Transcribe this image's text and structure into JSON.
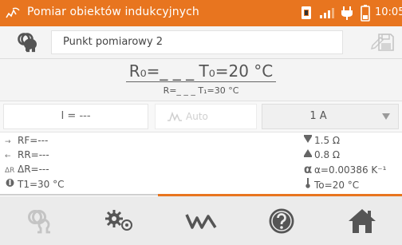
{
  "statusbar": {
    "title": "Pomiar obiektów indukcyjnych",
    "time": "10:05"
  },
  "point": {
    "name": "Punkt pomiarowy 2"
  },
  "result": {
    "r0_label": "R₀=",
    "r0_value": "_ _ _",
    "t0": "T₀=20 °C",
    "r_line": "R=_ _ _  T₁=30 °C"
  },
  "controls": {
    "current": "I = ---",
    "auto_label": "Auto",
    "range_value": "1 A"
  },
  "params": {
    "left": [
      {
        "prefix": "→",
        "text": "RF=---"
      },
      {
        "prefix": "←",
        "text": "RR=---"
      },
      {
        "prefix": "ΔR",
        "text": "ΔR=---"
      },
      {
        "prefix": "",
        "text": "T1=30 °C"
      }
    ],
    "right": [
      {
        "text": "1.5 Ω"
      },
      {
        "text": "0.8 Ω"
      },
      {
        "text": "α=0.00386 K⁻¹"
      },
      {
        "text": "To=20 °C"
      }
    ]
  },
  "colors": {
    "accent": "#e8751f",
    "toolbar_icon": "#555555",
    "disabled": "#bdbdbd"
  }
}
